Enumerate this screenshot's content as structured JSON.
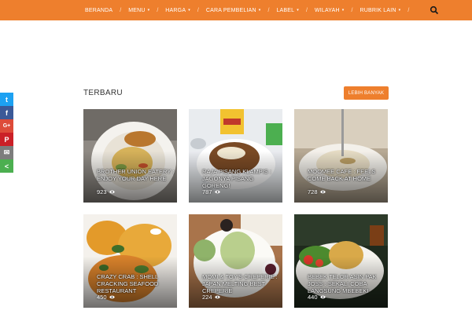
{
  "nav": {
    "items": [
      {
        "label": "BERANDA",
        "dropdown": false
      },
      {
        "label": "MENU",
        "dropdown": true
      },
      {
        "label": "HARGA",
        "dropdown": true
      },
      {
        "label": "CARA PEMBELIAN",
        "dropdown": true
      },
      {
        "label": "LABEL",
        "dropdown": true
      },
      {
        "label": "WILAYAH",
        "dropdown": true
      },
      {
        "label": "RUBRIK LAIN",
        "dropdown": true
      }
    ],
    "separator": "/",
    "caret": "▾",
    "search_icon": "search-icon",
    "bar_color": "#ee7f2d"
  },
  "share": [
    {
      "icon": "twitter-icon",
      "glyph": "t",
      "color": "#1da1f2"
    },
    {
      "icon": "facebook-icon",
      "glyph": "f",
      "color": "#3b5998"
    },
    {
      "icon": "google-plus-icon",
      "glyph": "G+",
      "color": "#dd4b39"
    },
    {
      "icon": "pinterest-icon",
      "glyph": "P",
      "color": "#cb2027"
    },
    {
      "icon": "email-icon",
      "glyph": "✉",
      "color": "#7d7d7d"
    },
    {
      "icon": "more-share-icon",
      "glyph": "<",
      "color": "#4caf50"
    }
  ],
  "section": {
    "title": "TERBARU",
    "more_label": "LEBIH BANYAK"
  },
  "posts": [
    {
      "title": "BROTHER UNION EATERY : ENJOY YOUR DAY HERE",
      "views": "923"
    },
    {
      "title": "RAJA PISANG KLAMPIS : JAGONYA PISANG GORENG!",
      "views": "787"
    },
    {
      "title": "MOOMEE CAFE : FEELS COME BACK AT HOME",
      "views": "728"
    },
    {
      "title": "CRAZY CRAB : SHELL CRACKING SEAFOOD RESTAURANT",
      "views": "450"
    },
    {
      "title": "MOMI & TOY'S CREPERIE : JAPAN MELTING BEST CREPERIE",
      "views": "224"
    },
    {
      "title": "BEBEK TELOR ASIN PAK JOSS : SEKALI COBA LANGSUNG MBEBEKI",
      "views": "440"
    }
  ]
}
